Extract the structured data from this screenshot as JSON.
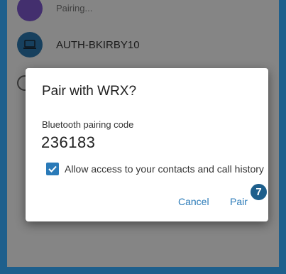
{
  "background_list": {
    "pairing_status": "Pairing...",
    "device_name": "AUTH-BKIRBY10"
  },
  "dialog": {
    "title": "Pair with WRX?",
    "code_label": "Bluetooth pairing code",
    "code": "236183",
    "contacts_access_label": "Allow access to your contacts and call history",
    "contacts_access_checked": true,
    "cancel_label": "Cancel",
    "pair_label": "Pair"
  },
  "step_badge": "7",
  "colors": {
    "accent": "#2a7ab8",
    "frame": "#1e5f8c",
    "pairing_icon": "#7a57c8"
  }
}
